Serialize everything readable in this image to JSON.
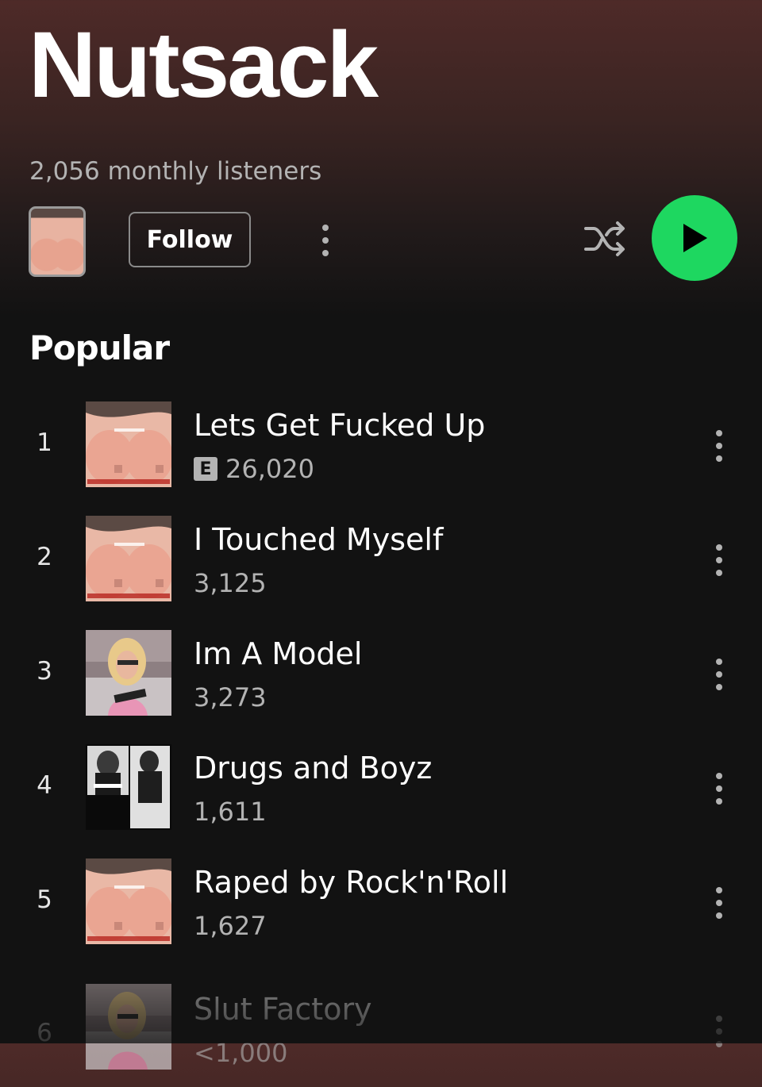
{
  "artist": {
    "name": "Nutsack",
    "monthly_listeners": "2,056 monthly listeners"
  },
  "controls": {
    "follow_label": "Follow",
    "more_icon": "more-vertical-icon",
    "shuffle_icon": "shuffle-icon",
    "play_icon": "play-icon"
  },
  "colors": {
    "accent": "#1ed760",
    "background": "#121212",
    "header_tint": "#4e2a28",
    "secondary_text": "#b3b3b3"
  },
  "popular": {
    "title": "Popular",
    "tracks": [
      {
        "rank": "1",
        "title": "Lets Get Fucked Up",
        "plays": "26,020",
        "explicit": true,
        "explicit_label": "E",
        "art": "breasts-cover"
      },
      {
        "rank": "2",
        "title": "I Touched Myself",
        "plays": "3,125",
        "explicit": false,
        "art": "breasts-cover"
      },
      {
        "rank": "3",
        "title": "Im A Model",
        "plays": "3,273",
        "explicit": false,
        "art": "model-cover"
      },
      {
        "rank": "4",
        "title": "Drugs and Boyz",
        "plays": "1,611",
        "explicit": false,
        "art": "bw-photos-cover"
      },
      {
        "rank": "5",
        "title": "Raped by Rock'n'Roll",
        "plays": "1,627",
        "explicit": false,
        "art": "breasts-cover"
      },
      {
        "rank": "6",
        "title": "Slut Factory",
        "plays": "<1,000",
        "explicit": false,
        "art": "model-cover"
      }
    ]
  }
}
